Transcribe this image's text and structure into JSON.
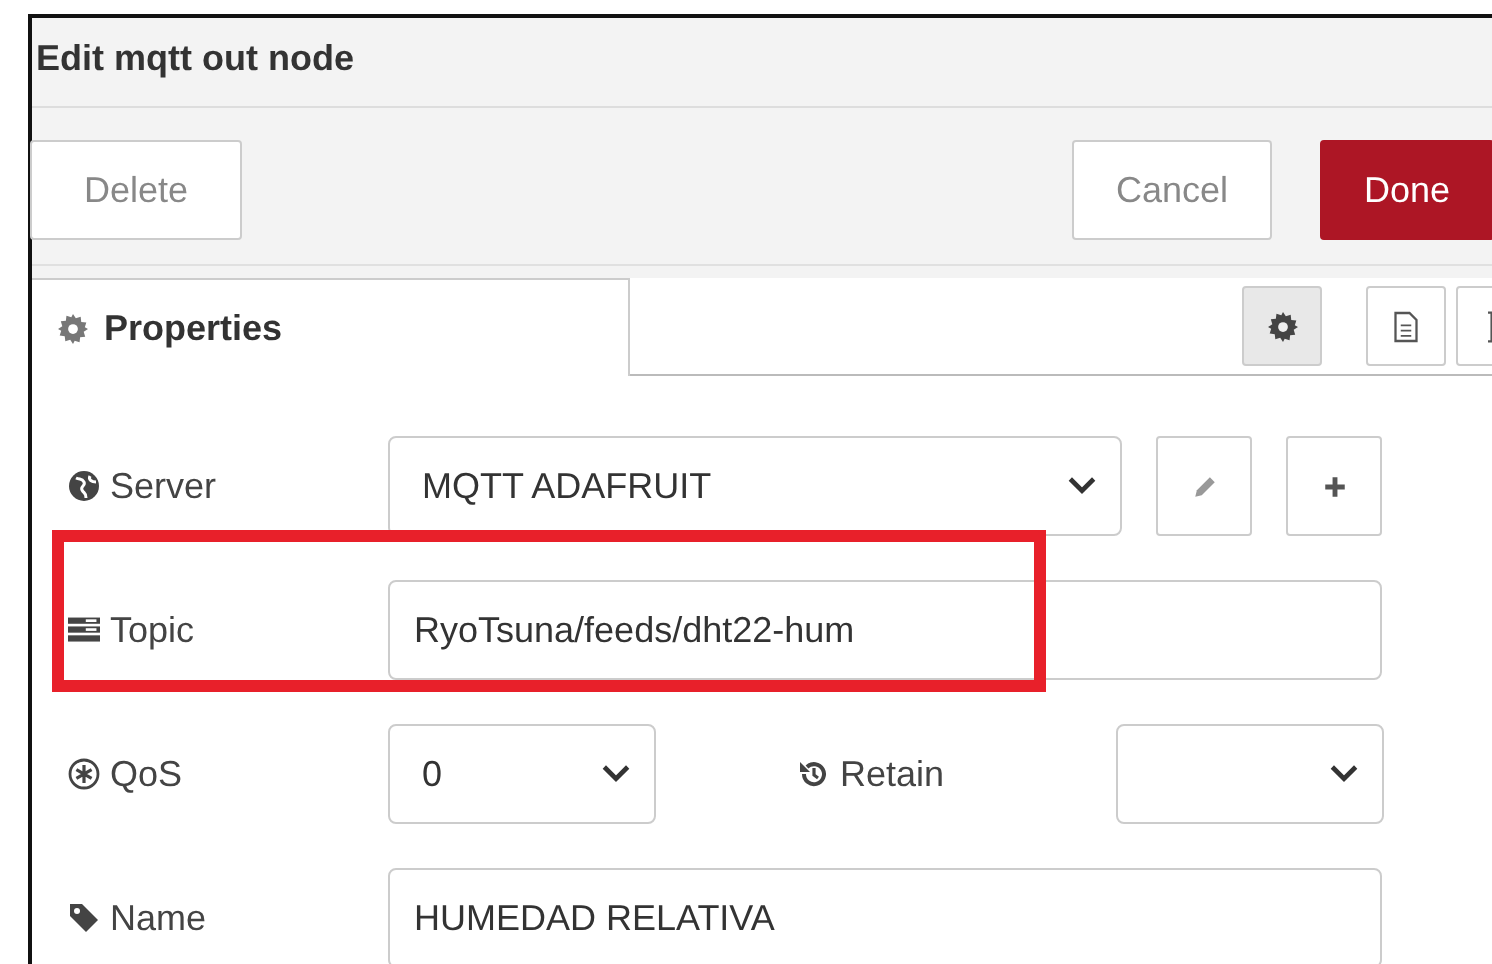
{
  "window": {
    "title": "Edit mqtt out node"
  },
  "buttons": [
    {
      "label": "Delete",
      "kind": "secondary"
    },
    {
      "label": "Cancel",
      "kind": "secondary"
    },
    {
      "label": "Done",
      "kind": "primary"
    }
  ],
  "tabs": [
    {
      "label": "Properties",
      "selected": true
    }
  ],
  "icon_tabs": [
    {
      "kind": "gear",
      "selected": true
    },
    {
      "kind": "document",
      "selected": false
    },
    {
      "kind": "partial",
      "selected": false
    }
  ],
  "form": {
    "server": {
      "label": "Server",
      "value": "MQTT ADAFRUIT"
    },
    "topic": {
      "label": "Topic",
      "value": "RyoTsuna/feeds/dht22-hum"
    },
    "qos": {
      "label": "QoS",
      "value": "0"
    },
    "retain": {
      "label": "Retain"
    },
    "name": {
      "label": "Name",
      "value": "HUMEDAD RELATIVA"
    }
  }
}
